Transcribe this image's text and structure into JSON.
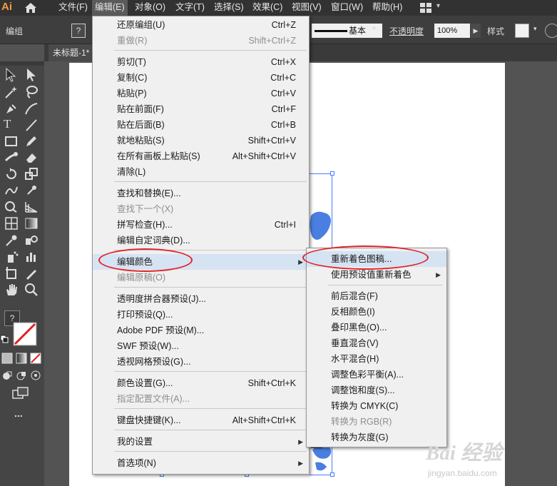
{
  "app": {
    "logo": "Ai"
  },
  "menubar": {
    "items": [
      "文件(F)",
      "编辑(E)",
      "对象(O)",
      "文字(T)",
      "选择(S)",
      "效果(C)",
      "视图(V)",
      "窗口(W)",
      "帮助(H)"
    ]
  },
  "controlbar": {
    "selection_label": "编组",
    "help": "?",
    "stroke_style": "基本",
    "opacity_label": "不透明度",
    "opacity_value": "100%",
    "style_label": "样式"
  },
  "document": {
    "tab_title": "未标题-1*"
  },
  "toolbar": {
    "help": "?",
    "more": "..."
  },
  "edit_menu": {
    "items": [
      {
        "label": "还原编组(U)",
        "shortcut": "Ctrl+Z",
        "enabled": true
      },
      {
        "label": "重做(R)",
        "shortcut": "Shift+Ctrl+Z",
        "enabled": false
      },
      {
        "label": "剪切(T)",
        "shortcut": "Ctrl+X",
        "enabled": true
      },
      {
        "label": "复制(C)",
        "shortcut": "Ctrl+C",
        "enabled": true
      },
      {
        "label": "粘贴(P)",
        "shortcut": "Ctrl+V",
        "enabled": true
      },
      {
        "label": "贴在前面(F)",
        "shortcut": "Ctrl+F",
        "enabled": true
      },
      {
        "label": "贴在后面(B)",
        "shortcut": "Ctrl+B",
        "enabled": true
      },
      {
        "label": "就地粘贴(S)",
        "shortcut": "Shift+Ctrl+V",
        "enabled": true
      },
      {
        "label": "在所有画板上粘贴(S)",
        "shortcut": "Alt+Shift+Ctrl+V",
        "enabled": true
      },
      {
        "label": "清除(L)",
        "shortcut": "",
        "enabled": true
      },
      {
        "label": "查找和替换(E)...",
        "shortcut": "",
        "enabled": true
      },
      {
        "label": "查找下一个(X)",
        "shortcut": "",
        "enabled": false
      },
      {
        "label": "拼写检查(H)...",
        "shortcut": "Ctrl+I",
        "enabled": true
      },
      {
        "label": "编辑自定词典(D)...",
        "shortcut": "",
        "enabled": true
      },
      {
        "label": "编辑颜色",
        "shortcut": "",
        "enabled": true,
        "submenu": true,
        "highlighted": true
      },
      {
        "label": "编辑原稿(O)",
        "shortcut": "",
        "enabled": false
      },
      {
        "label": "透明度拼合器预设(J)...",
        "shortcut": "",
        "enabled": true
      },
      {
        "label": "打印预设(Q)...",
        "shortcut": "",
        "enabled": true
      },
      {
        "label": "Adobe PDF 预设(M)...",
        "shortcut": "",
        "enabled": true
      },
      {
        "label": "SWF 预设(W)...",
        "shortcut": "",
        "enabled": true
      },
      {
        "label": "透视网格预设(G)...",
        "shortcut": "",
        "enabled": true
      },
      {
        "label": "颜色设置(G)...",
        "shortcut": "Shift+Ctrl+K",
        "enabled": true
      },
      {
        "label": "指定配置文件(A)...",
        "shortcut": "",
        "enabled": false
      },
      {
        "label": "键盘快捷键(K)...",
        "shortcut": "Alt+Shift+Ctrl+K",
        "enabled": true
      },
      {
        "label": "我的设置",
        "shortcut": "",
        "enabled": true,
        "submenu": true
      },
      {
        "label": "首选项(N)",
        "shortcut": "",
        "enabled": true,
        "submenu": true
      }
    ]
  },
  "color_submenu": {
    "items": [
      {
        "label": "重新着色图稿...",
        "enabled": true,
        "highlighted": true
      },
      {
        "label": "使用预设值重新着色",
        "enabled": true,
        "submenu": true
      },
      {
        "label": "前后混合(F)",
        "enabled": true
      },
      {
        "label": "反相颜色(I)",
        "enabled": true
      },
      {
        "label": "叠印黑色(O)...",
        "enabled": true
      },
      {
        "label": "垂直混合(V)",
        "enabled": true
      },
      {
        "label": "水平混合(H)",
        "enabled": true
      },
      {
        "label": "调整色彩平衡(A)...",
        "enabled": true
      },
      {
        "label": "调整饱和度(S)...",
        "enabled": true
      },
      {
        "label": "转换为 CMYK(C)",
        "enabled": true
      },
      {
        "label": "转换为 RGB(R)",
        "enabled": false
      },
      {
        "label": "转换为灰度(G)",
        "enabled": true
      }
    ]
  },
  "watermark": {
    "logo": "Bai 经验",
    "url": "jingyan.baidu.com"
  },
  "colors": {
    "accent": "#4a7bff",
    "annotation": "#e0242a",
    "menu_bg": "#f0f0f0",
    "highlight": "#d6e3f2",
    "app_logo": "#f29c38"
  }
}
